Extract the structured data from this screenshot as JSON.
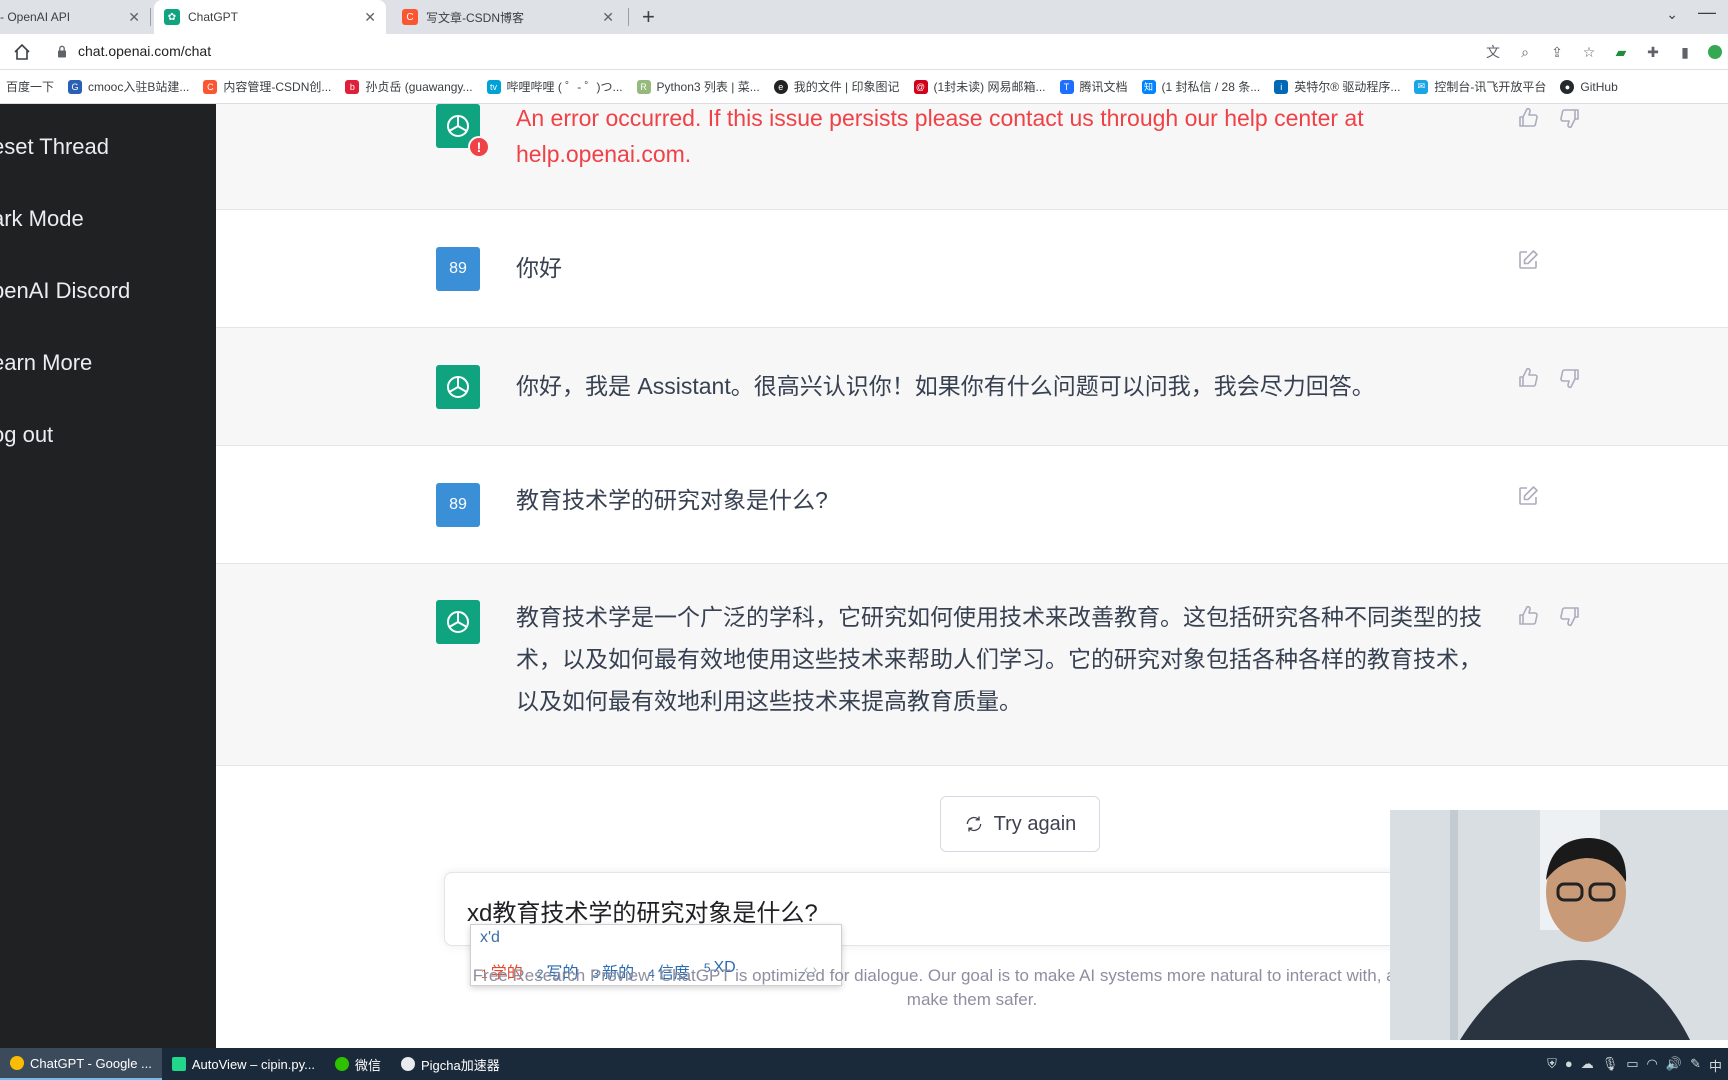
{
  "browser": {
    "tabs": [
      {
        "title": "- OpenAI API",
        "icon": "openai-icon"
      },
      {
        "title": "ChatGPT",
        "icon": "chatgpt-icon"
      },
      {
        "title": "写文章-CSDN博客",
        "icon": "csdn-icon"
      }
    ],
    "url": "chat.openai.com/chat",
    "bookmarks": [
      "百度一下",
      "cmooc入驻B站建...",
      "内容管理-CSDN创...",
      "孙贞岳 (guawangy...",
      "哔哩哔哩 ( ゜- ゜)つ...",
      "Python3 列表 | 菜...",
      "我的文件 | 印象图记",
      "(1封未读) 网易邮箱...",
      "腾讯文档",
      "(1 封私信 / 28 条...",
      "英特尔® 驱动程序...",
      "控制台-讯飞开放平台",
      "GitHub"
    ]
  },
  "sidebar": {
    "items": [
      "eset Thread",
      "ark Mode",
      "penAI Discord",
      "earn More",
      "og out"
    ]
  },
  "conversation": {
    "error_message": "An error occurred. If this issue persists please contact us through our help center at help.openai.com.",
    "user_avatar_label": "89",
    "messages": [
      {
        "role": "user",
        "text": "你好"
      },
      {
        "role": "assistant",
        "text": "你好，我是 Assistant。很高兴认识你！如果你有什么问题可以问我，我会尽力回答。"
      },
      {
        "role": "user",
        "text": "教育技术学的研究对象是什么?"
      },
      {
        "role": "assistant",
        "text": "教育技术学是一个广泛的学科，它研究如何使用技术来改善教育。这包括研究各种不同类型的技术，以及如何最有效地使用这些技术来帮助人们学习。它的研究对象包括各种各样的教育技术，以及如何最有效地利用这些技术来提高教育质量。"
      }
    ]
  },
  "try_again_label": "Try again",
  "input": {
    "value": "xd教育技术学的研究对象是什么?"
  },
  "ime": {
    "composition": "x'd",
    "candidates": [
      {
        "num": "1",
        "text": "学的"
      },
      {
        "num": "2",
        "text": "写的"
      },
      {
        "num": "3",
        "text": "新的"
      },
      {
        "num": "4",
        "text": "信度"
      },
      {
        "num": "5",
        "text": "XD"
      }
    ]
  },
  "footer_note": {
    "line1": "Free Research Preview: ChatGPT is optimized for dialogue. Our goal is to make AI systems more natural to interact with, and your fe",
    "line2": "make them safer."
  },
  "taskbar": {
    "items": [
      "ChatGPT - Google ...",
      "AutoView – cipin.py...",
      "微信",
      "Pigcha加速器"
    ]
  },
  "colors": {
    "sidebar_bg": "#202123",
    "assistant_avatar": "#10a37f",
    "user_avatar": "#3a8fd6",
    "error": "#ef4146"
  }
}
